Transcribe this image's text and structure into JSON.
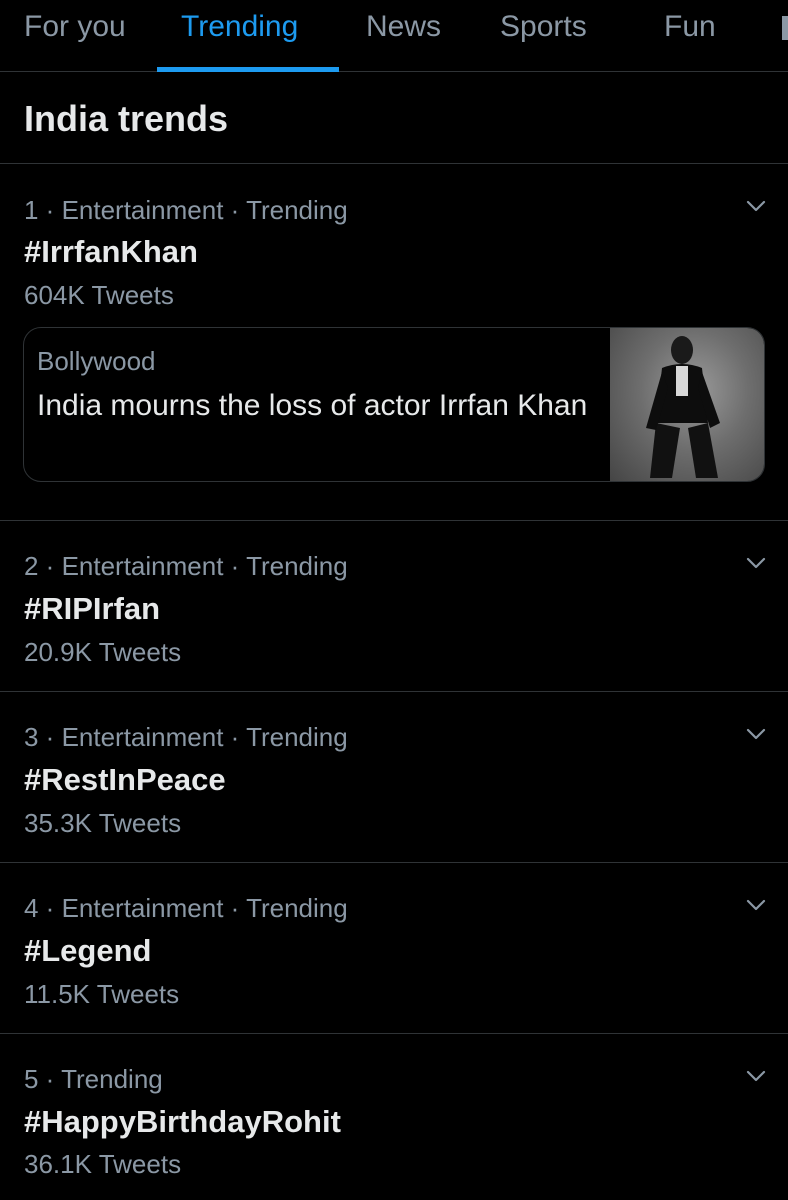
{
  "tabs": [
    {
      "label": "For you"
    },
    {
      "label": "Trending"
    },
    {
      "label": "News"
    },
    {
      "label": "Sports"
    },
    {
      "label": "Fun"
    }
  ],
  "active_tab": "Trending",
  "accent_color": "#1d9bf0",
  "section_title": "India trends",
  "trends": [
    {
      "meta": "1 · Entertainment · Trending",
      "tag": "#IrrfanKhan",
      "count": "604K Tweets"
    },
    {
      "meta": "2 · Entertainment · Trending",
      "tag": "#RIPIrfan",
      "count": "20.9K Tweets"
    },
    {
      "meta": "3 · Entertainment · Trending",
      "tag": "#RestInPeace",
      "count": "35.3K Tweets"
    },
    {
      "meta": "4 · Entertainment · Trending",
      "tag": "#Legend",
      "count": "11.5K Tweets"
    },
    {
      "meta": "5 · Trending",
      "tag": "#HappyBirthdayRohit",
      "count": "36.1K Tweets"
    }
  ],
  "news_card": {
    "category": "Bollywood",
    "headline": "India mourns the loss of actor Irrfan Khan"
  }
}
